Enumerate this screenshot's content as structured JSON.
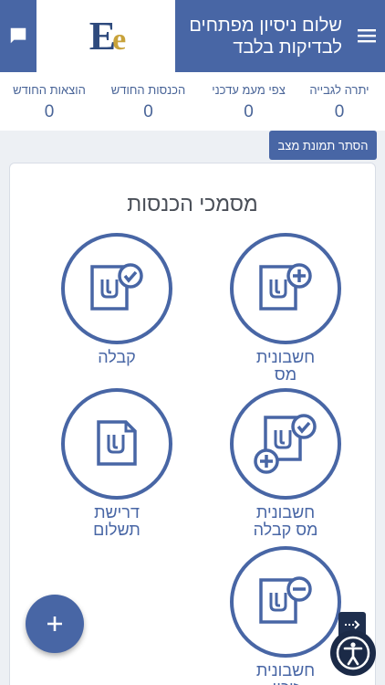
{
  "header": {
    "title": "שלום ניסיון מפתחים לבדיקות בלבד",
    "logo": {
      "main": "E",
      "accent": "e"
    },
    "menu_icon": "hamburger-menu-icon",
    "chat_icon": "chat-icon"
  },
  "stats": [
    {
      "label": "יתרה לגבייה",
      "value": "0"
    },
    {
      "label": "צפי מעמ עדכני",
      "value": "0"
    },
    {
      "label": "הכנסות החודש",
      "value": "0"
    },
    {
      "label": "הוצאות החודש",
      "value": "0"
    }
  ],
  "hide_button_label": "הסתר תמונת מצב",
  "section_title": "מסמכי הכנסות",
  "documents": [
    {
      "label": "חשבונית מס",
      "icon": "doc-plus-icon"
    },
    {
      "label": "קבלה",
      "icon": "doc-check-icon"
    },
    {
      "label": "חשבונית מס קבלה",
      "icon": "doc-plus-check-icon"
    },
    {
      "label": "דרישת תשלום",
      "icon": "doc-corner-icon"
    },
    {
      "label": "חשבונית זיכוי",
      "icon": "doc-minus-icon"
    }
  ],
  "fab_label": "+",
  "colors": {
    "primary": "#4866a5",
    "background": "#edf0f4",
    "text": "#4a6598"
  }
}
